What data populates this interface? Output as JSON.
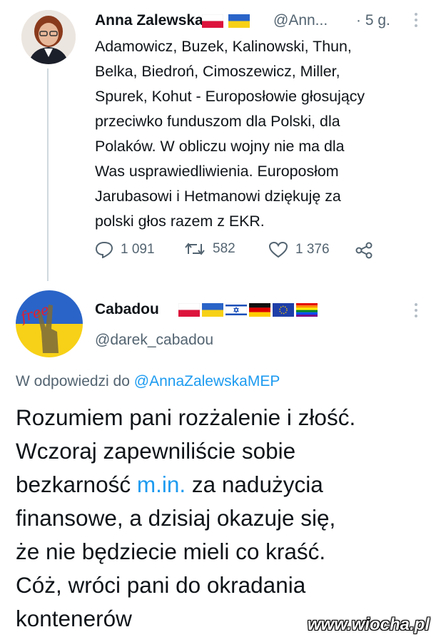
{
  "tweet1": {
    "author_name": "Anna Zalewska",
    "handle": "@Ann...",
    "time": "· 5 g.",
    "body_lines": [
      "Adamowicz, Buzek, Kalinowski, Thun,",
      "Belka, Biedroń, Cimoszewicz, Miller,",
      "Spurek, Kohut - Europosłowie głosujący",
      "przeciwko funduszom dla Polski, dla",
      "Polaków. W obliczu wojny nie ma dla",
      "Was usprawiedliwienia. Europosłom",
      "Jarubasowi i Hetmanowi dziękuję za",
      "polski głos razem z EKR."
    ],
    "actions": {
      "replies": "1 091",
      "retweets": "582",
      "likes": "1 376"
    },
    "icons": [
      "reply-icon",
      "retweet-icon",
      "like-icon",
      "share-icon",
      "more-icon"
    ]
  },
  "tweet2": {
    "author_name": "Cabadou",
    "handle": "@darek_cabadou",
    "avatar_text": "free",
    "reply_prefix": "W odpowiedzi do",
    "reply_mention": "@AnnaZalewskaMEP",
    "body": {
      "line1": "Rozumiem pani rozżalenie i złość.",
      "line2": "Wczoraj zapewniliście sobie",
      "line3_pre": "bezkarność ",
      "line3_link": "m.in.",
      "line3_post": " za nadużycia",
      "line4": "finansowe, a dzisiaj okazuje się,",
      "line5": "że nie będziecie mieli co kraść.",
      "line6": "Cóż, wróci pani do okradania",
      "line7": "kontenerów"
    }
  },
  "watermark": "www.wiocha.pl",
  "colors": {
    "link": "#1d9bf0",
    "secondary_text": "#536471",
    "primary_text": "#0f1419"
  }
}
